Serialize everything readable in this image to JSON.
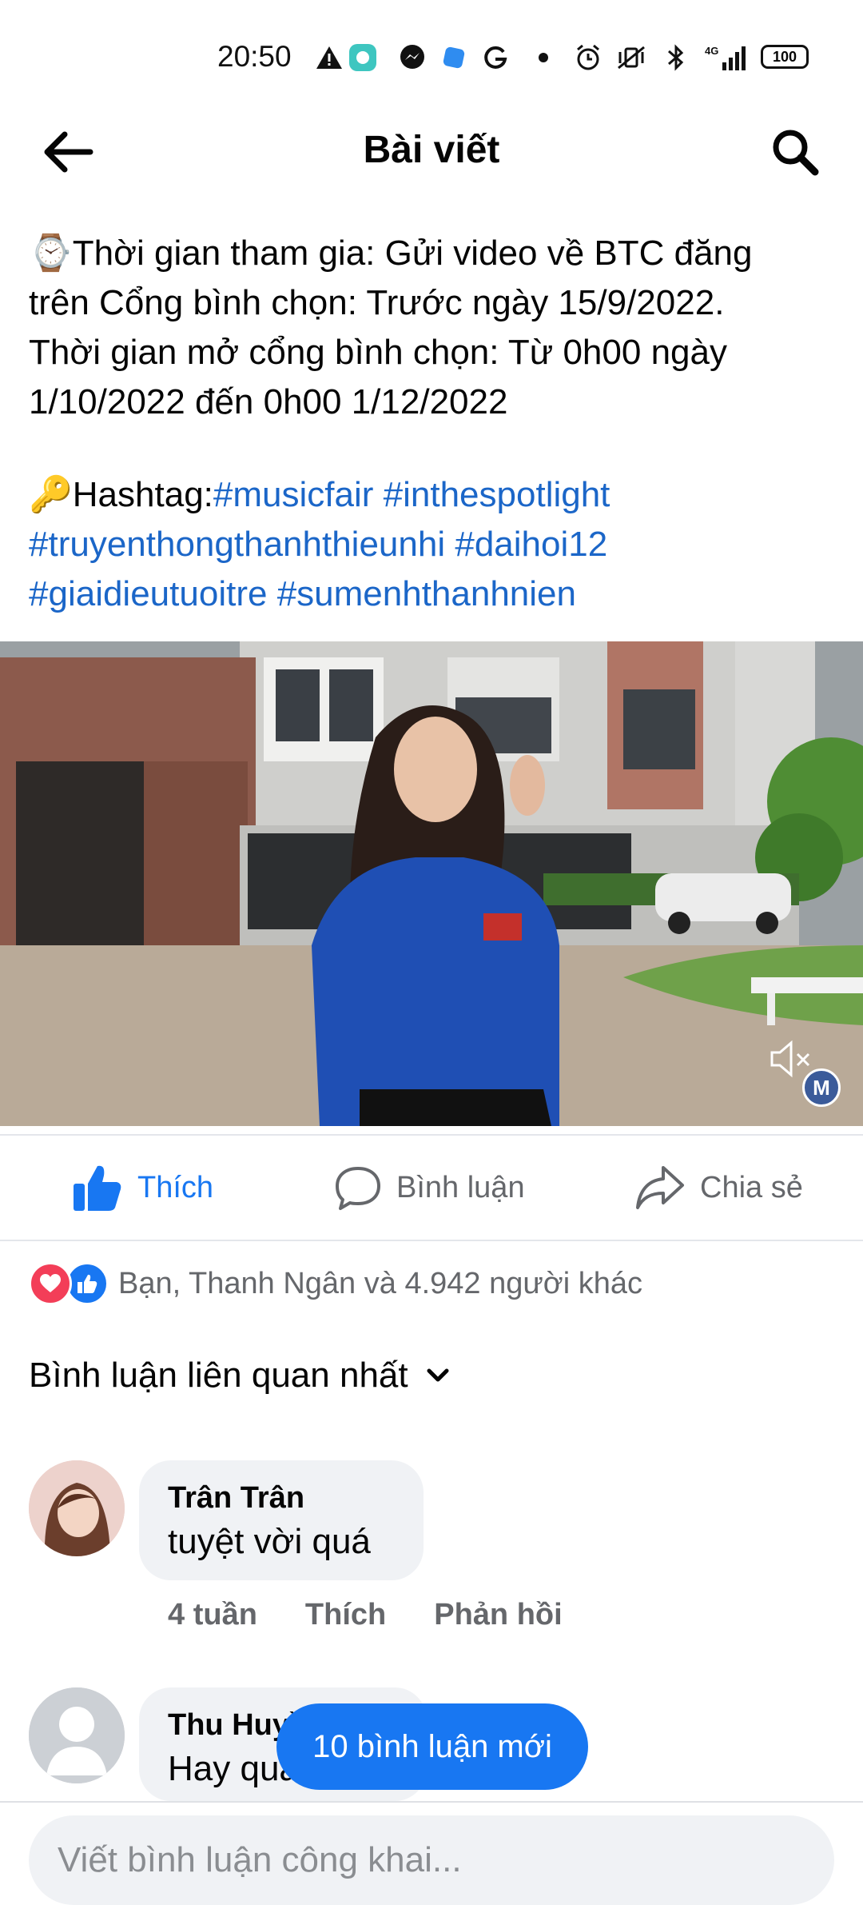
{
  "status_bar": {
    "time": "20:50",
    "battery": "100",
    "network": "4G",
    "icons": [
      "warning-icon",
      "chat-app-icon",
      "messenger-icon",
      "app-icon",
      "g-icon",
      "dot-icon",
      "alarm-icon",
      "vibrate-icon",
      "bluetooth-icon",
      "signal-icon"
    ]
  },
  "header": {
    "title": "Bài viết",
    "back_icon": "arrow-left-icon",
    "search_icon": "search-icon"
  },
  "post": {
    "lines": [
      "⌚Thời gian tham gia: Gửi video về BTC đăng",
      "trên Cổng bình chọn: Trước ngày 15/9/2022.",
      "Thời gian mở cổng bình chọn: Từ 0h00 ngày",
      "1/10/2022 đến 0h00 1/12/2022"
    ],
    "hashtag_prefix": "🔑Hashtag:",
    "hashtags": [
      "#musicfair",
      "#inthespotlight",
      "#truyenthongthanhthieunhi",
      "#daihoi12",
      "#giaidieutuoitre",
      "#sumenhthanhnien"
    ]
  },
  "video": {
    "mute_icon": "speaker-muted-icon",
    "watermark_logo": "M"
  },
  "actions": {
    "like": "Thích",
    "comment": "Bình luận",
    "share": "Chia sẻ"
  },
  "reactions": {
    "summary": "Bạn, Thanh Ngân và 4.942 người khác"
  },
  "comments_sort": {
    "label": "Bình luận liên quan nhất"
  },
  "comments": [
    {
      "author": "Trân Trân",
      "text": "tuyệt vời quá",
      "time": "4 tuần",
      "like": "Thích",
      "reply": "Phản hồi"
    },
    {
      "author": "Thu Huyền",
      "text": "Hay quá"
    }
  ],
  "new_comments_pill": "10 bình luận mới",
  "composer": {
    "placeholder": "Viết bình luận công khai..."
  },
  "colors": {
    "accent": "#1877f2",
    "hashtag": "#1b66c8",
    "secondary_text": "#65676b"
  }
}
